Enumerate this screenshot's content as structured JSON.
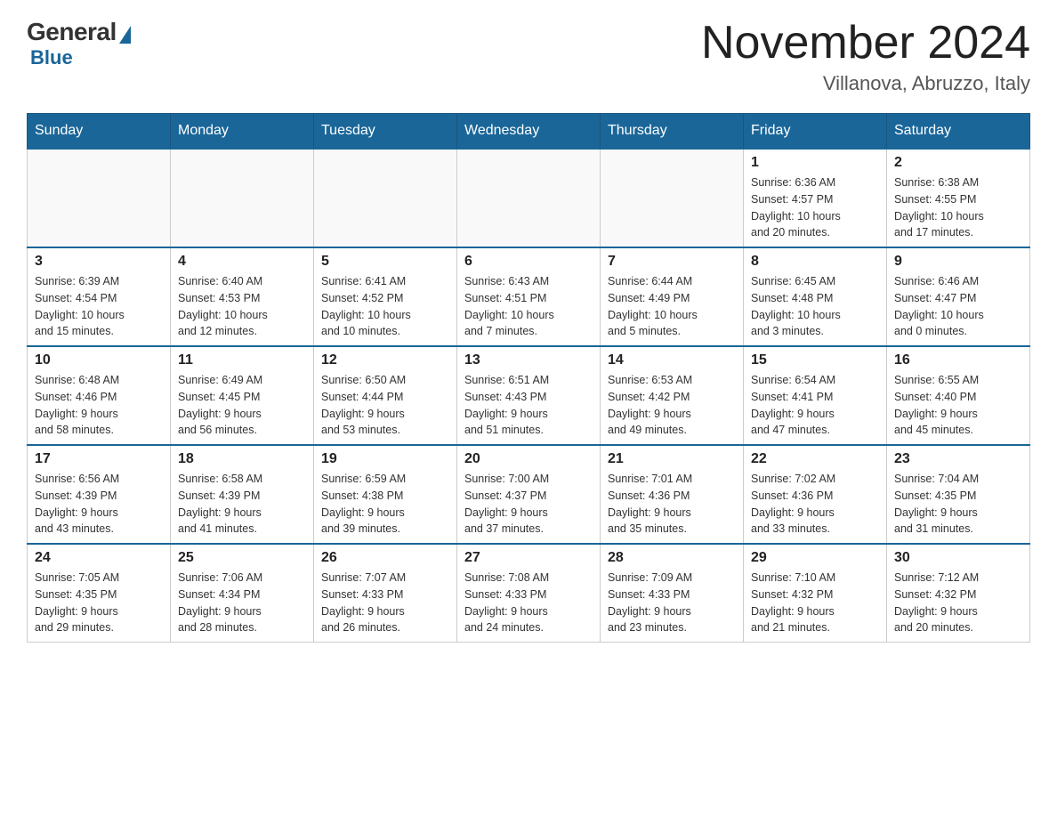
{
  "header": {
    "logo_general": "General",
    "logo_blue": "Blue",
    "title": "November 2024",
    "subtitle": "Villanova, Abruzzo, Italy"
  },
  "weekdays": [
    "Sunday",
    "Monday",
    "Tuesday",
    "Wednesday",
    "Thursday",
    "Friday",
    "Saturday"
  ],
  "weeks": [
    [
      {
        "day": "",
        "info": ""
      },
      {
        "day": "",
        "info": ""
      },
      {
        "day": "",
        "info": ""
      },
      {
        "day": "",
        "info": ""
      },
      {
        "day": "",
        "info": ""
      },
      {
        "day": "1",
        "info": "Sunrise: 6:36 AM\nSunset: 4:57 PM\nDaylight: 10 hours\nand 20 minutes."
      },
      {
        "day": "2",
        "info": "Sunrise: 6:38 AM\nSunset: 4:55 PM\nDaylight: 10 hours\nand 17 minutes."
      }
    ],
    [
      {
        "day": "3",
        "info": "Sunrise: 6:39 AM\nSunset: 4:54 PM\nDaylight: 10 hours\nand 15 minutes."
      },
      {
        "day": "4",
        "info": "Sunrise: 6:40 AM\nSunset: 4:53 PM\nDaylight: 10 hours\nand 12 minutes."
      },
      {
        "day": "5",
        "info": "Sunrise: 6:41 AM\nSunset: 4:52 PM\nDaylight: 10 hours\nand 10 minutes."
      },
      {
        "day": "6",
        "info": "Sunrise: 6:43 AM\nSunset: 4:51 PM\nDaylight: 10 hours\nand 7 minutes."
      },
      {
        "day": "7",
        "info": "Sunrise: 6:44 AM\nSunset: 4:49 PM\nDaylight: 10 hours\nand 5 minutes."
      },
      {
        "day": "8",
        "info": "Sunrise: 6:45 AM\nSunset: 4:48 PM\nDaylight: 10 hours\nand 3 minutes."
      },
      {
        "day": "9",
        "info": "Sunrise: 6:46 AM\nSunset: 4:47 PM\nDaylight: 10 hours\nand 0 minutes."
      }
    ],
    [
      {
        "day": "10",
        "info": "Sunrise: 6:48 AM\nSunset: 4:46 PM\nDaylight: 9 hours\nand 58 minutes."
      },
      {
        "day": "11",
        "info": "Sunrise: 6:49 AM\nSunset: 4:45 PM\nDaylight: 9 hours\nand 56 minutes."
      },
      {
        "day": "12",
        "info": "Sunrise: 6:50 AM\nSunset: 4:44 PM\nDaylight: 9 hours\nand 53 minutes."
      },
      {
        "day": "13",
        "info": "Sunrise: 6:51 AM\nSunset: 4:43 PM\nDaylight: 9 hours\nand 51 minutes."
      },
      {
        "day": "14",
        "info": "Sunrise: 6:53 AM\nSunset: 4:42 PM\nDaylight: 9 hours\nand 49 minutes."
      },
      {
        "day": "15",
        "info": "Sunrise: 6:54 AM\nSunset: 4:41 PM\nDaylight: 9 hours\nand 47 minutes."
      },
      {
        "day": "16",
        "info": "Sunrise: 6:55 AM\nSunset: 4:40 PM\nDaylight: 9 hours\nand 45 minutes."
      }
    ],
    [
      {
        "day": "17",
        "info": "Sunrise: 6:56 AM\nSunset: 4:39 PM\nDaylight: 9 hours\nand 43 minutes."
      },
      {
        "day": "18",
        "info": "Sunrise: 6:58 AM\nSunset: 4:39 PM\nDaylight: 9 hours\nand 41 minutes."
      },
      {
        "day": "19",
        "info": "Sunrise: 6:59 AM\nSunset: 4:38 PM\nDaylight: 9 hours\nand 39 minutes."
      },
      {
        "day": "20",
        "info": "Sunrise: 7:00 AM\nSunset: 4:37 PM\nDaylight: 9 hours\nand 37 minutes."
      },
      {
        "day": "21",
        "info": "Sunrise: 7:01 AM\nSunset: 4:36 PM\nDaylight: 9 hours\nand 35 minutes."
      },
      {
        "day": "22",
        "info": "Sunrise: 7:02 AM\nSunset: 4:36 PM\nDaylight: 9 hours\nand 33 minutes."
      },
      {
        "day": "23",
        "info": "Sunrise: 7:04 AM\nSunset: 4:35 PM\nDaylight: 9 hours\nand 31 minutes."
      }
    ],
    [
      {
        "day": "24",
        "info": "Sunrise: 7:05 AM\nSunset: 4:35 PM\nDaylight: 9 hours\nand 29 minutes."
      },
      {
        "day": "25",
        "info": "Sunrise: 7:06 AM\nSunset: 4:34 PM\nDaylight: 9 hours\nand 28 minutes."
      },
      {
        "day": "26",
        "info": "Sunrise: 7:07 AM\nSunset: 4:33 PM\nDaylight: 9 hours\nand 26 minutes."
      },
      {
        "day": "27",
        "info": "Sunrise: 7:08 AM\nSunset: 4:33 PM\nDaylight: 9 hours\nand 24 minutes."
      },
      {
        "day": "28",
        "info": "Sunrise: 7:09 AM\nSunset: 4:33 PM\nDaylight: 9 hours\nand 23 minutes."
      },
      {
        "day": "29",
        "info": "Sunrise: 7:10 AM\nSunset: 4:32 PM\nDaylight: 9 hours\nand 21 minutes."
      },
      {
        "day": "30",
        "info": "Sunrise: 7:12 AM\nSunset: 4:32 PM\nDaylight: 9 hours\nand 20 minutes."
      }
    ]
  ]
}
